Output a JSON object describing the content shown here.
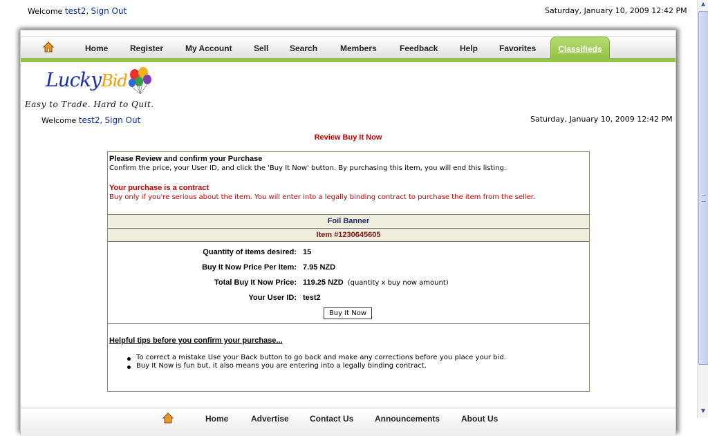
{
  "top": {
    "welcome_prefix": "Welcome",
    "username": "test2",
    "separator": ",",
    "sign_out": "Sign Out",
    "datetime": "Saturday, January 10, 2009 12:42 PM"
  },
  "nav": {
    "items": [
      "Home",
      "Register",
      "My Account",
      "Sell",
      "Search",
      "Members",
      "Feedback",
      "Help",
      "Favorites"
    ],
    "active_tab": "Classifieds",
    "home_icon": "home-icon"
  },
  "logo": {
    "word1": "Lucky",
    "word2": "Bid",
    "tagline": "Easy to Trade. Hard to Quit."
  },
  "inner": {
    "welcome_prefix": "Welcome",
    "username": "test2",
    "separator": ",",
    "sign_out": "Sign Out",
    "datetime": "Saturday, January 10, 2009 12:42 PM"
  },
  "page": {
    "title": "Review Buy It Now",
    "confirm_heading": "Please Review and confirm your Purchase",
    "confirm_text": "Confirm the price, your User ID, and click the 'Buy It Now' button. By purchasing this item, you will end this listing.",
    "contract_heading": "Your purchase is a contract",
    "contract_text": "Buy only if you're serious about the item. You will enter into a legally binding contract to purchase the item from the seller.",
    "item_title": "Foil Banner",
    "item_number": "Item #1230645605",
    "quantity_label": "Quantity of items desired:",
    "quantity_value": "15",
    "price_label": "Buy It Now Price Per Item:",
    "price_value": "7.95 NZD",
    "total_label": "Total Buy It Now Price:",
    "total_value": "119.25 NZD",
    "total_note": "(quantity x buy now amount)",
    "userid_label": "Your User ID:",
    "userid_value": "test2",
    "buy_button": "Buy It Now",
    "tips_title": "Helpful tips before you confirm your purchase...",
    "tips": [
      "To correct a mistake Use your Back button to go back and make any corrections before you place your bid.",
      "Buy It Now is fun but, it also means you are entering into a legally binding contract."
    ]
  },
  "footer": {
    "items": [
      "Home",
      "Advertise",
      "Contact Us",
      "Announcements",
      "About Us"
    ]
  },
  "colors": {
    "accent_green": "#96c34a",
    "alert_red": "#c00000",
    "link_blue": "#0a2e9a"
  }
}
